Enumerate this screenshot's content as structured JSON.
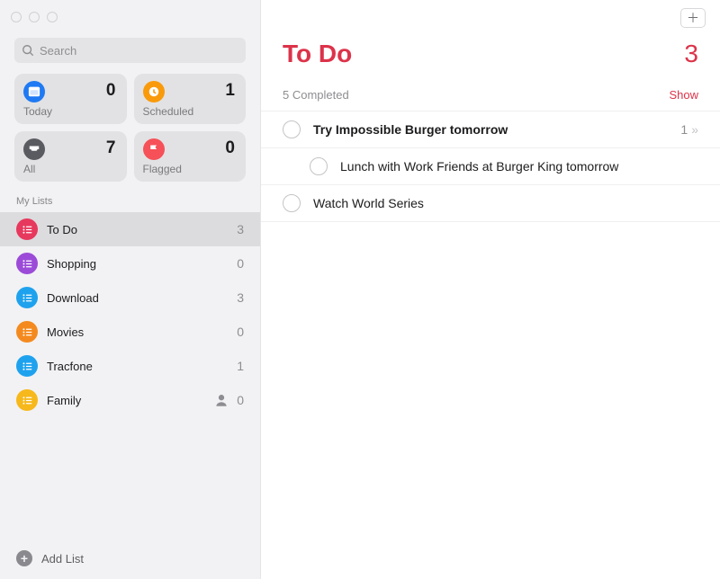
{
  "search": {
    "placeholder": "Search"
  },
  "smart": {
    "today": {
      "label": "Today",
      "count": 0,
      "color": "#1f7af3"
    },
    "scheduled": {
      "label": "Scheduled",
      "count": 1,
      "color": "#f99a0b"
    },
    "all": {
      "label": "All",
      "count": 7,
      "color": "#5a5b60"
    },
    "flagged": {
      "label": "Flagged",
      "count": 0,
      "color": "#f65058"
    }
  },
  "sidebar": {
    "section": "My Lists",
    "items": [
      {
        "name": "To Do",
        "count": 3,
        "color": "#e7385d",
        "shared": false,
        "selected": true
      },
      {
        "name": "Shopping",
        "count": 0,
        "color": "#9b4bd8",
        "shared": false,
        "selected": false
      },
      {
        "name": "Download",
        "count": 3,
        "color": "#1fa2ee",
        "shared": false,
        "selected": false
      },
      {
        "name": "Movies",
        "count": 0,
        "color": "#f48a1f",
        "shared": false,
        "selected": false
      },
      {
        "name": "Tracfone",
        "count": 1,
        "color": "#1fa2ee",
        "shared": false,
        "selected": false
      },
      {
        "name": "Family",
        "count": 0,
        "color": "#f6b81b",
        "shared": true,
        "selected": false
      }
    ],
    "add_list": "Add List"
  },
  "main": {
    "title": "To Do",
    "count": 3,
    "completed_text": "5 Completed",
    "show_label": "Show",
    "todos": [
      {
        "title": "Try Impossible Burger tomorrow",
        "bold": true,
        "subcount": "1",
        "subtask": {
          "title": "Lunch with Work Friends at Burger King tomorrow"
        }
      },
      {
        "title": "Watch World Series",
        "bold": false
      }
    ]
  }
}
